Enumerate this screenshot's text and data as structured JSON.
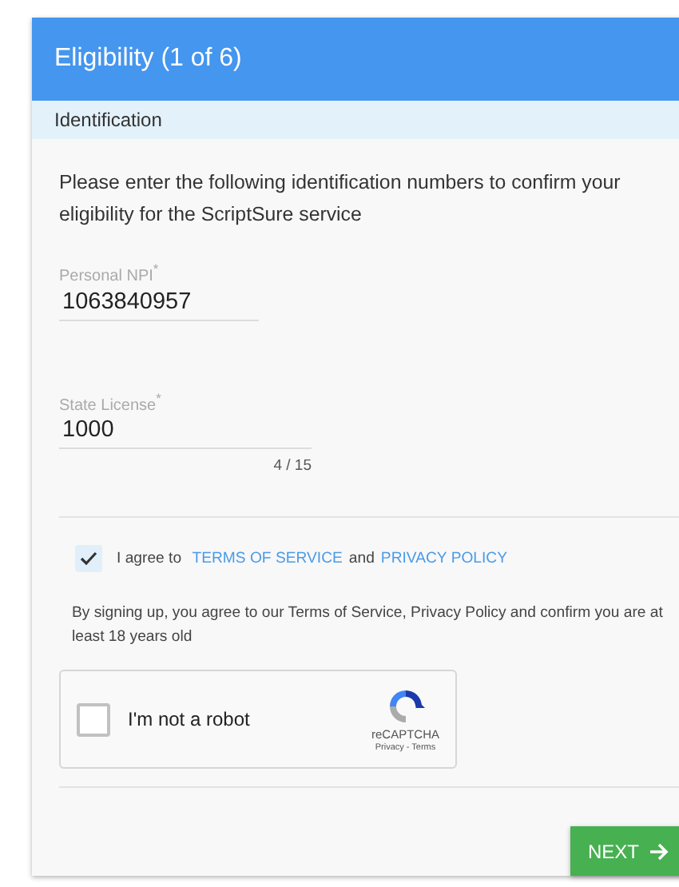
{
  "header": {
    "title": "Eligibility (1 of 6)"
  },
  "section": {
    "title": "Identification"
  },
  "intro": "Please enter the following identification numbers to confirm your eligibility for the ScriptSure service",
  "fields": [
    {
      "label": "Personal NPI",
      "required_mark": "*",
      "value": "1063840957"
    },
    {
      "label": "State License",
      "required_mark": "*",
      "value": "1000",
      "counter": "4 / 15"
    }
  ],
  "agreement": {
    "checked": true,
    "prefix": "I agree to",
    "terms_link": "TERMS OF SERVICE",
    "joiner": "and",
    "privacy_link": "PRIVACY POLICY"
  },
  "disclaimer": "By signing up, you agree to our Terms of Service, Privacy Policy and confirm you are at least 18 years old",
  "captcha": {
    "checked": false,
    "label": "I'm not a robot",
    "brand": "reCAPTCHA",
    "links": "Privacy - Terms"
  },
  "next_button": {
    "label": "NEXT"
  }
}
